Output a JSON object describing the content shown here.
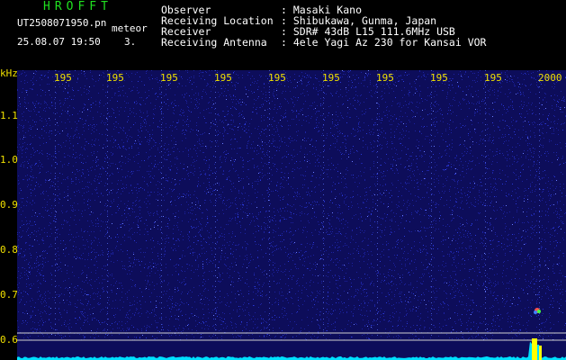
{
  "header": {
    "app_title": "HROFFT",
    "file_name": "UT2508071950.pn",
    "meteor_label": "meteor",
    "timestamp": "25.08.07 19:50",
    "count": "3.",
    "info": [
      {
        "label": "Observer",
        "value": ": Masaki Kano"
      },
      {
        "label": "Receiving Location",
        "value": ": Shibukawa, Gunma, Japan"
      },
      {
        "label": "Receiver",
        "value": ": SDR# 43dB L15 111.6MHz USB"
      },
      {
        "label": "Receiving Antenna",
        "value": ": 4ele Yagi Az 230 for Kansai VOR"
      }
    ]
  },
  "axes": {
    "y_unit": "kHz",
    "y_ticks": [
      "1.1",
      "1.0",
      "0.9",
      "0.8",
      "0.7",
      "0.6"
    ],
    "x_ticks": [
      "195",
      "195",
      "195",
      "195",
      "195",
      "195",
      "195",
      "195",
      "195",
      "2000"
    ]
  },
  "colors": {
    "background": "#000000",
    "plot_bg": "#0d0d5a",
    "title": "#20e020",
    "axis_text": "#f0e000",
    "spectrum": "#00e0ff",
    "peak": "#ffff00"
  }
}
